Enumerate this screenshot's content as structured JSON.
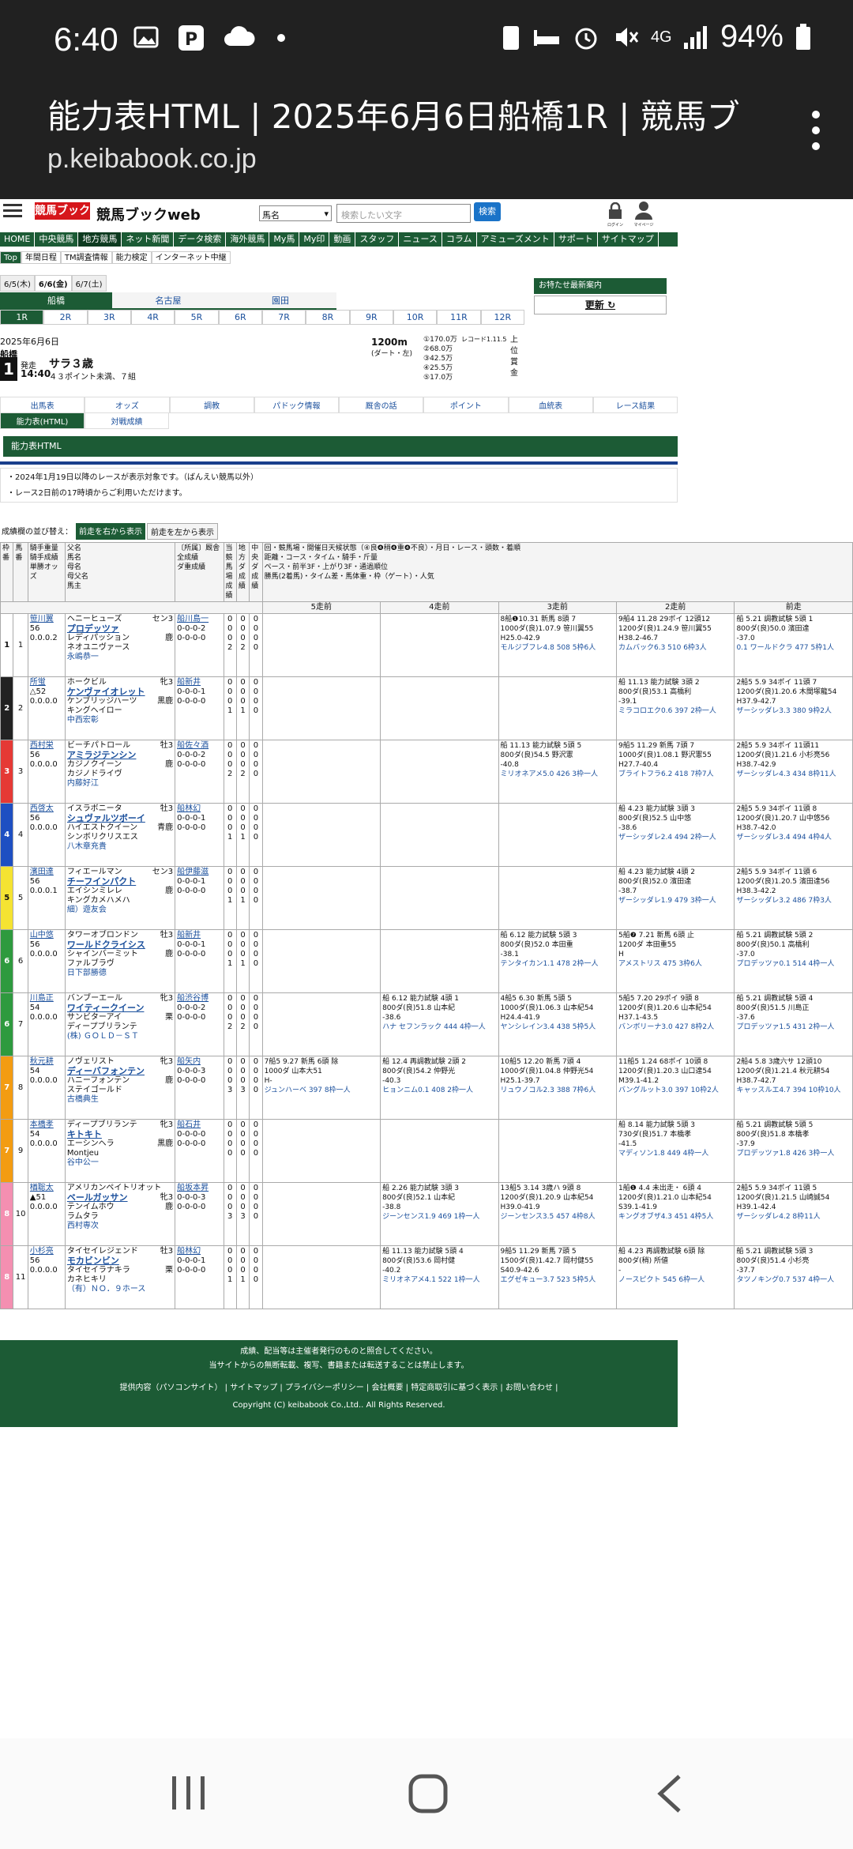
{
  "status": {
    "time": "6:40",
    "battery": "94%",
    "net": "4G"
  },
  "browser": {
    "title": "能力表HTML | 2025年6月6日船橋1R | 競馬ブ...",
    "url": "p.keibabook.co.jp"
  },
  "site": {
    "logo": "競馬ブック",
    "name": "競馬ブックweb",
    "search_select": "馬名",
    "search_placeholder": "検索したい文字",
    "search_btn": "検索",
    "login": "ログイン",
    "mypage": "マイページ"
  },
  "nav1": [
    "HOME",
    "中央競馬",
    "地方競馬",
    "ネット新聞",
    "データ検索",
    "海外競馬",
    "My馬",
    "My印",
    "動画",
    "スタッフ",
    "ニュース",
    "コラム",
    "アミューズメント",
    "サポート",
    "サイトマップ"
  ],
  "nav2": [
    "Top",
    "年間日程",
    "TM調査情報",
    "能力検定",
    "インターネット中継"
  ],
  "dates": [
    "6/5(木)",
    "6/6(金)",
    "6/7(土)"
  ],
  "tracks": [
    "船橋",
    "名古屋",
    "園田"
  ],
  "races": [
    "1R",
    "2R",
    "3R",
    "4R",
    "5R",
    "6R",
    "7R",
    "8R",
    "9R",
    "10R",
    "11R",
    "12R"
  ],
  "notice": {
    "title": "お特たせ最新案内",
    "update": "更新"
  },
  "race": {
    "date": "2025年6月6日",
    "track": "船橋",
    "no": "1",
    "start_label": "発走",
    "start": "14:40",
    "name": "サラ３歳",
    "cond": "４３ポイント未満、７組",
    "dist": "1200m",
    "course": "(ダート・左)",
    "record": "レコード1.11.5",
    "prizes": [
      "①170.0万",
      "②68.0万",
      "③42.5万",
      "④25.5万",
      "⑤17.0万"
    ],
    "side": [
      "上",
      "位",
      "賞",
      "金"
    ]
  },
  "menu": [
    "出馬表",
    "オッズ",
    "調教",
    "パドック情報",
    "厩舎の話",
    "ポイント",
    "血統表",
    "レース結果"
  ],
  "menu2": [
    "能力表(HTML)",
    "対戦成績"
  ],
  "section": "能力表HTML",
  "notes": [
    "・2024年1月19日以降のレースが表示対象です。（ばんえい競馬以外）",
    "・レース2日前の17時頃からご利用いただけます。"
  ],
  "order": {
    "label": "成績欄の並び替え：",
    "a": "前走を右から表示",
    "b": "前走を左から表示"
  },
  "head": {
    "waku": "枠番",
    "uma": "馬番",
    "jockey": "騎手重量騎手成績単勝オッズ",
    "horse": "父名\n馬名\n母名\n母父名\n馬主",
    "sex": "性年齢\n毛色",
    "stable": "〔所属〕厩舎\n全成績\nダ重成績",
    "c1": "当競馬場成績",
    "c2": "地方ダ成績",
    "c3": "中央ダ成績",
    "legend": [
      "回・競馬場・開催日天候状態（④良❹稍❹重❹不良）・月日・レース・頭数・着順",
      "距離・コース・タイム・騎手・斤量",
      "ペース・前半3F・上がり3F・通過順位",
      "勝馬(2着馬)・タイム差・馬体重・枠（ゲート）・人気"
    ],
    "runs": [
      "5走前",
      "4走前",
      "3走前",
      "2走前",
      "前走"
    ]
  },
  "horses": [
    {
      "w": "1",
      "u": "1",
      "j": "笹川翼",
      "wt": "56",
      "js": "0.0.0.2",
      "sire": "ヘニーヒューズ",
      "sex": "セン3",
      "name": "プロデッツァ",
      "dam": "レディパッション",
      "bms": "ネオユニヴァース",
      "owner": "永嶋恭一",
      "color": "鹿",
      "st": "船川島一",
      "rec": "0-0-0-2",
      "rec2": "0-0-0-0",
      "a": [
        "0",
        "0",
        "0",
        "2"
      ],
      "b": [
        "0",
        "0",
        "0",
        "2"
      ],
      "c": [
        "0",
        "0",
        "0",
        "0"
      ],
      "r": [
        "",
        "",
        "8船❶10.31 新馬 8頭 7|1000ダ(良)1.07.9 笹川翼55|H25.0-42.9|モルジブフレ4.8 508 5枠6人",
        "9船4 11.28 29ポイ 12頭12|1200ダ(良)1.24.9 笹川翼55|H38.2-46.7|カムバック6.3 510 6枠3人",
        "船 5.21 調教試験 5頭 1|800ダ(良)50.0 濱田達|-37.0|0.1 ワールドクラ 477 5枠1人"
      ]
    },
    {
      "w": "2",
      "u": "2",
      "j": "所蛍",
      "wt": "△52",
      "js": "0.0.0.0",
      "sire": "ホークビル",
      "sex": "牝3",
      "name": "ケンヴァイオレット",
      "dam": "ケンブリッジハーツ",
      "bms": "キングヘイロー",
      "owner": "中西宏彰",
      "color": "黒鹿",
      "st": "船新井",
      "rec": "0-0-0-1",
      "rec2": "0-0-0-0",
      "a": [
        "0",
        "0",
        "0",
        "1"
      ],
      "b": [
        "0",
        "0",
        "0",
        "1"
      ],
      "c": [
        "0",
        "0",
        "0",
        "0"
      ],
      "r": [
        "",
        "",
        "",
        "船 11.13 能力試験 3頭 2|800ダ(良)53.1 高橋利|-39.1|ミラコロエク0.6 397 2枠一人",
        "2船5 5.9 34ポイ 11頭 7|1200ダ(良)1.20.6 木間塚龍54|H37.9-42.7|ザーシッダレ3.3 380 9枠2人"
      ]
    },
    {
      "w": "3",
      "u": "3",
      "j": "西村栄",
      "wt": "56",
      "js": "0.0.0.0",
      "sire": "ビーチパトロール",
      "sex": "牡3",
      "name": "アミラジテンシン",
      "dam": "カジノクイーン",
      "bms": "カジノドライヴ",
      "owner": "内藤好江",
      "color": "鹿",
      "st": "船佐々酒",
      "rec": "0-0-0-2",
      "rec2": "0-0-0-0",
      "a": [
        "0",
        "0",
        "0",
        "2"
      ],
      "b": [
        "0",
        "0",
        "0",
        "2"
      ],
      "c": [
        "0",
        "0",
        "0",
        "0"
      ],
      "r": [
        "",
        "",
        "船 11.13 能力試験 5頭 5|800ダ(良)54.5 野沢憲|-40.8|ミリオネアメ5.0 426 3枠一人",
        "9船5 11.29 新馬 7頭 7|1000ダ(良)1.08.1 野沢憲55|H27.7-40.4|ブライトフラ6.2 418 7枠7人",
        "2船5 5.9 34ポイ 11頭11|1200ダ(良)1.21.6 小杉亮56|H38.7-42.9|ザーシッダレ4.3 434 8枠11人"
      ]
    },
    {
      "w": "4",
      "u": "4",
      "j": "西啓太",
      "wt": "56",
      "js": "0.0.0.0",
      "sire": "イスラボニータ",
      "sex": "牡3",
      "name": "シュヴァルツボーイ",
      "dam": "ハイエストクイーン",
      "bms": "シンボリクリスエス",
      "owner": "八木章充貴",
      "color": "青鹿",
      "st": "船林幻",
      "rec": "0-0-0-1",
      "rec2": "0-0-0-0",
      "a": [
        "0",
        "0",
        "0",
        "1"
      ],
      "b": [
        "0",
        "0",
        "0",
        "1"
      ],
      "c": [
        "0",
        "0",
        "0",
        "0"
      ],
      "r": [
        "",
        "",
        "",
        "船 4.23 能力試験 3頭 3|800ダ(良)52.5 山中悠|-38.6|ザーシッダレ2.4 494 2枠一人",
        "2船5 5.9 34ポイ 11頭 8|1200ダ(良)1.20.7 山中悠56|H38.7-42.0|ザーシッダレ3.4 494 4枠4人"
      ]
    },
    {
      "w": "5",
      "u": "5",
      "j": "濱田達",
      "wt": "56",
      "js": "0.0.0.1",
      "sire": "フィエールマン",
      "sex": "セン3",
      "name": "チーフインパクト",
      "dam": "エイシンミレレ",
      "bms": "キングカメハメハ",
      "owner": "細）遊友会",
      "color": "鹿",
      "st": "船伊藤滋",
      "rec": "0-0-0-1",
      "rec2": "0-0-0-0",
      "a": [
        "0",
        "0",
        "0",
        "1"
      ],
      "b": [
        "0",
        "0",
        "0",
        "1"
      ],
      "c": [
        "0",
        "0",
        "0",
        "0"
      ],
      "r": [
        "",
        "",
        "",
        "船 4.23 能力試験 4頭 2|800ダ(良)52.0 濱田達|-38.7|ザーシッダレ1.9 479 3枠一人",
        "2船5 5.9 34ポイ 11頭 6|1200ダ(良)1.20.5 濱田達56|H38.3-42.2|ザーシッダレ3.2 486 7枠3人"
      ]
    },
    {
      "w": "6",
      "u": "6",
      "j": "山中悠",
      "wt": "56",
      "js": "0.0.0.0",
      "sire": "タワーオブロンドン",
      "sex": "牡3",
      "name": "ワールドクライシス",
      "dam": "シャインバーミット",
      "bms": "ファルブラヴ",
      "owner": "日下部勝德",
      "color": "鹿",
      "st": "船新井",
      "rec": "0-0-0-1",
      "rec2": "0-0-0-0",
      "a": [
        "0",
        "0",
        "0",
        "1"
      ],
      "b": [
        "0",
        "0",
        "0",
        "1"
      ],
      "c": [
        "0",
        "0",
        "0",
        "0"
      ],
      "r": [
        "",
        "",
        "船 6.12 能力試験 5頭 3|800ダ(良)52.0 本田重|-38.1|テンタイカン1.1 478 2枠一人",
        "5船❼ 7.21 新馬 6頭 止|1200ダ 本田重55|H |アメストリス 475 3枠6人",
        "船 5.21 調教試験 5頭 2|800ダ(良)50.1 高橋利|-37.0|プロデッツァ0.1 514 4枠一人"
      ]
    },
    {
      "w": "6",
      "u": "7",
      "j": "川島正",
      "wt": "54",
      "js": "0.0.0.0",
      "sire": "バンブーエール",
      "sex": "牝3",
      "name": "ワイティークイーン",
      "dam": "サンビターアイ",
      "bms": "ディープブリランテ",
      "owner": "(株) ＧＯＬＤ－ＳＴ",
      "color": "栗",
      "st": "船渋谷博",
      "rec": "0-0-0-2",
      "rec2": "0-0-0-0",
      "a": [
        "0",
        "0",
        "0",
        "2"
      ],
      "b": [
        "0",
        "0",
        "0",
        "2"
      ],
      "c": [
        "0",
        "0",
        "0",
        "0"
      ],
      "r": [
        "",
        "船 6.12 能力試験 4頭 1|800ダ(良)51.8 山本紀|-38.6|ハナ セフンラック 444 4枠一人",
        "4船5 6.30 新馬 5頭 5|1000ダ(良)1.06.3 山本紀54|H24.4-41.9|ヤンシレイン3.4 438 5枠5人",
        "5船5 7.20 29ポイ 9頭 8|1200ダ(良)1.20.6 山本紀54|H37.1-43.5|バンボリーナ3.0 427 8枠2人",
        "船 5.21 調教試験 5頭 4|800ダ(良)51.5 川島正|-37.6|プロデッツァ1.5 431 2枠一人"
      ]
    },
    {
      "w": "7",
      "u": "8",
      "j": "秋元耕",
      "wt": "54",
      "js": "0.0.0.0",
      "sire": "ノヴェリスト",
      "sex": "牝3",
      "name": "ディーバフォンテン",
      "dam": "ハニーフォンテン",
      "bms": "ステイゴールド",
      "owner": "古橋典生",
      "color": "鹿",
      "st": "船矢内",
      "rec": "0-0-0-3",
      "rec2": "0-0-0-0",
      "a": [
        "0",
        "0",
        "0",
        "3"
      ],
      "b": [
        "0",
        "0",
        "0",
        "3"
      ],
      "c": [
        "0",
        "0",
        "0",
        "0"
      ],
      "r": [
        "7船5 9.27 新馬 6頭 除|1000ダ 山本大51|H-|ジュンハーベ 397 8枠一人",
        "船 12.4 再調教試験 2頭 2|800ダ(良)54.2 仲野光|-40.3|ヒョンニム0.1 408 2枠一人",
        "10船5 12.20 新馬 7頭 4|1000ダ(良)1.04.8 仲野光54|H25.1-39.7|リュウノコル2.3 388 7枠6人",
        "11船5 1.24 68ポイ 10頭 8|1200ダ(良)1.20.3 山口達54|M39.1-41.2|バングルット3.0 397 10枠2人",
        "2船4 5.8 3歳六サ 12頭10|1200ダ(良)1.21.4 秋元耕54|H38.7-42.7|キャッスルエ4.7 394 10枠10人"
      ]
    },
    {
      "w": "7",
      "u": "9",
      "j": "本橋孝",
      "wt": "54",
      "js": "0.0.0.0",
      "sire": "ディープブリランテ",
      "sex": "牝3",
      "name": "キトキト",
      "dam": "エーシンヘラ",
      "bms": "Montjeu",
      "owner": "谷中公一",
      "color": "黒鹿",
      "st": "船石井",
      "rec": "0-0-0-0",
      "rec2": "0-0-0-0",
      "a": [
        "0",
        "0",
        "0",
        "0"
      ],
      "b": [
        "0",
        "0",
        "0",
        "0"
      ],
      "c": [
        "0",
        "0",
        "0",
        "0"
      ],
      "r": [
        "",
        "",
        "",
        "船 8.14 能力試験 5頭 3|730ダ(良)51.7 本橋孝|-41.5|マディソン1.8 449 4枠一人",
        "船 5.21 調教試験 5頭 5|800ダ(良)51.8 本橋孝|-37.9|プロデッツァ1.8 426 3枠一人"
      ]
    },
    {
      "w": "8",
      "u": "10",
      "j": "楢聡太",
      "wt": "▲51",
      "js": "0.0.0.0",
      "sire": "アメリカンペイトリオット",
      "sex": "牝3",
      "name": "ベールガッサン",
      "dam": "テンイムホウ",
      "bms": "ラムタラ",
      "owner": "西村専次",
      "color": "鹿",
      "st": "船坂本昇",
      "rec": "0-0-0-3",
      "rec2": "0-0-0-0",
      "a": [
        "0",
        "0",
        "0",
        "3"
      ],
      "b": [
        "0",
        "0",
        "0",
        "3"
      ],
      "c": [
        "0",
        "0",
        "0",
        "0"
      ],
      "r": [
        "",
        "船 2.26 能力試験 3頭 3|800ダ(良)52.1 山本紀|-38.8|ジーンセンス1.9 469 1枠一人",
        "13船5 3.14 3歳ハ 9頭 8|1200ダ(良)1.20.9 山本紀54|H39.0-41.9|ジーンセンス3.5 457 4枠8人",
        "1船❶ 4.4 未出走・ 6頭 4|1200ダ(良)1.21.0 山本紀54|S39.1-41.9|キングオブザ4.3 451 4枠5人",
        "2船5 5.9 34ポイ 11頭 5|1200ダ(良)1.21.5 山崎誠54|H39.1-42.4|ザーシッダレ4.2 8枠11人"
      ]
    },
    {
      "w": "8",
      "u": "11",
      "j": "小杉亮",
      "wt": "56",
      "js": "0.0.0.0",
      "sire": "タイセイレジェンド",
      "sex": "牡3",
      "name": "モカビンビン",
      "dam": "タイセイラナキラ",
      "bms": "カネヒキリ",
      "owner": "（有）ＮＯ．９ホース",
      "color": "栗",
      "st": "船林幻",
      "rec": "0-0-0-1",
      "rec2": "0-0-0-0",
      "a": [
        "0",
        "0",
        "0",
        "1"
      ],
      "b": [
        "0",
        "0",
        "0",
        "1"
      ],
      "c": [
        "0",
        "0",
        "0",
        "0"
      ],
      "r": [
        "",
        "船 11.13 能力試験 5頭 4|800ダ(良)53.6 岡村健|-40.2|ミリオネアメ4.1 522 1枠一人",
        "9船5 11.29 新馬 7頭 5|1500ダ(良)1.42.7 岡村健55|S40.9-42.6|エグゼキュー3.7 523 5枠5人",
        "船 4.23 再調教試験 6頭 除|800ダ(稍) 所値|-|ノースピクト 545 6枠一人",
        "船 5.21 調教試験 5頭 3|800ダ(良)51.4 小杉亮|-37.7|タツノキング0.7 537 4枠一人"
      ]
    }
  ],
  "footer": {
    "l1": "成績、配当等は主催者発行のものと照合してください。",
    "l2": "当サイトからの無断転載、複写、書籍または転送することは禁止します。",
    "links": "提供内容（パソコンサイト） | サイトマップ | プライバシーポリシー | 会社概要 | 特定商取引に基づく表示 | お問い合わせ |",
    "copy": "Copyright (C) keibabook Co.,Ltd.. All Rights Reserved."
  },
  "colors": {
    "green": "#1c5b35",
    "waku": [
      "#ffffff",
      "#222222",
      "#e53935",
      "#1e4fc2",
      "#f5e332",
      "#2e9a3e",
      "#f39c12",
      "#f48fb1"
    ]
  }
}
